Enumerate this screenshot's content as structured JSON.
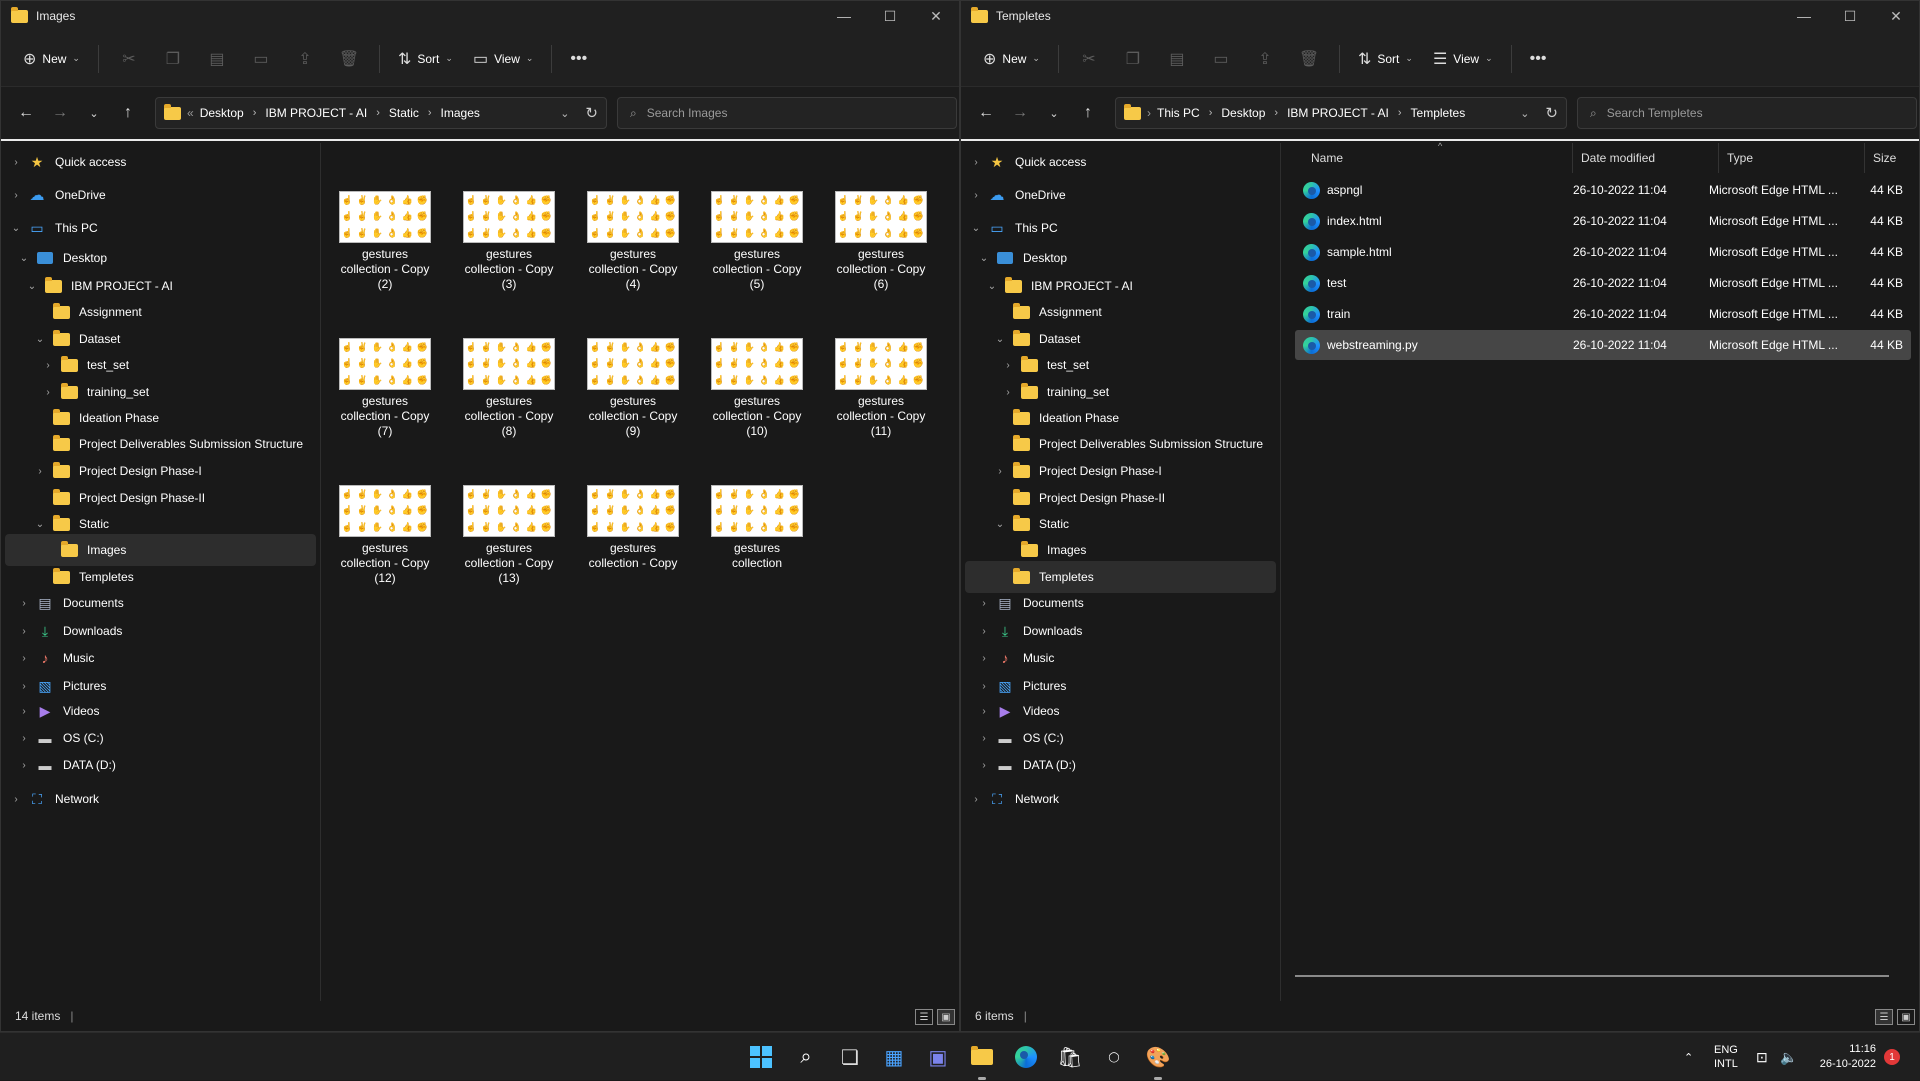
{
  "left": {
    "title": "Images",
    "toolbar": {
      "new": "New",
      "sort": "Sort",
      "view": "View"
    },
    "breadcrumb": [
      "Desktop",
      "IBM PROJECT - AI",
      "Static",
      "Images"
    ],
    "search_placeholder": "Search Images",
    "status": "14 items",
    "files": [
      [
        "gestures",
        "collection - Copy",
        "(2)"
      ],
      [
        "gestures",
        "collection - Copy",
        "(3)"
      ],
      [
        "gestures",
        "collection - Copy",
        "(4)"
      ],
      [
        "gestures",
        "collection - Copy",
        "(5)"
      ],
      [
        "gestures",
        "collection - Copy",
        "(6)"
      ],
      [
        "gestures",
        "collection - Copy",
        "(7)"
      ],
      [
        "gestures",
        "collection - Copy",
        "(8)"
      ],
      [
        "gestures",
        "collection - Copy",
        "(9)"
      ],
      [
        "gestures",
        "collection - Copy",
        "(10)"
      ],
      [
        "gestures",
        "collection - Copy",
        "(11)"
      ],
      [
        "gestures",
        "collection - Copy",
        "(12)"
      ],
      [
        "gestures",
        "collection - Copy",
        "(13)"
      ],
      [
        "gestures",
        "collection - Copy",
        ""
      ],
      [
        "gestures",
        "collection",
        ""
      ]
    ]
  },
  "right": {
    "title": "Templetes",
    "toolbar": {
      "new": "New",
      "sort": "Sort",
      "view": "View"
    },
    "breadcrumb": [
      "This PC",
      "Desktop",
      "IBM PROJECT - AI",
      "Templetes"
    ],
    "search_placeholder": "Search Templetes",
    "status": "6 items",
    "columns": [
      "Name",
      "Date modified",
      "Type",
      "Size"
    ],
    "rows": [
      {
        "name": "aspngl",
        "date": "26-10-2022 11:04",
        "type": "Microsoft Edge HTML ...",
        "size": "44 KB"
      },
      {
        "name": "index.html",
        "date": "26-10-2022 11:04",
        "type": "Microsoft Edge HTML ...",
        "size": "44 KB"
      },
      {
        "name": "sample.html",
        "date": "26-10-2022 11:04",
        "type": "Microsoft Edge HTML ...",
        "size": "44 KB"
      },
      {
        "name": "test",
        "date": "26-10-2022 11:04",
        "type": "Microsoft Edge HTML ...",
        "size": "44 KB"
      },
      {
        "name": "train",
        "date": "26-10-2022 11:04",
        "type": "Microsoft Edge HTML ...",
        "size": "44 KB"
      },
      {
        "name": "webstreaming.py",
        "date": "26-10-2022 11:04",
        "type": "Microsoft Edge HTML ...",
        "size": "44 KB"
      }
    ]
  },
  "nav": [
    {
      "label": "Quick access",
      "icon": "star-icon",
      "level": 0,
      "exp": "›"
    },
    {
      "label": "OneDrive",
      "icon": "cloud-icon",
      "level": 0,
      "exp": "›"
    },
    {
      "label": "This PC",
      "icon": "pc-icon",
      "level": 0,
      "exp": "⌄"
    },
    {
      "label": "Desktop",
      "icon": "desktop-icon",
      "level": 1,
      "exp": "⌄"
    },
    {
      "label": "IBM PROJECT - AI",
      "icon": "folder-icon",
      "level": 2,
      "exp": "⌄"
    },
    {
      "label": "Assignment",
      "icon": "folder-icon",
      "level": 3,
      "exp": ""
    },
    {
      "label": "Dataset",
      "icon": "folder-icon",
      "level": 3,
      "exp": "⌄"
    },
    {
      "label": "test_set",
      "icon": "folder-icon",
      "level": 4,
      "exp": "›"
    },
    {
      "label": "training_set",
      "icon": "folder-icon",
      "level": 4,
      "exp": "›"
    },
    {
      "label": "Ideation Phase",
      "icon": "folder-icon",
      "level": 3,
      "exp": ""
    },
    {
      "label": "Project Deliverables Submission Structure",
      "icon": "folder-icon",
      "level": 3,
      "exp": ""
    },
    {
      "label": "Project Design Phase-I",
      "icon": "folder-icon",
      "level": 3,
      "exp": "›"
    },
    {
      "label": "Project Design Phase-II",
      "icon": "folder-icon",
      "level": 3,
      "exp": ""
    },
    {
      "label": "Static",
      "icon": "folder-icon",
      "level": 3,
      "exp": "⌄"
    },
    {
      "label": "Images",
      "icon": "folder-icon",
      "level": 4,
      "exp": ""
    },
    {
      "label": "Templetes",
      "icon": "folder-icon",
      "level": 3,
      "exp": ""
    },
    {
      "label": "Documents",
      "icon": "documents-icon",
      "level": 1,
      "exp": "›"
    },
    {
      "label": "Downloads",
      "icon": "downloads-icon",
      "level": 1,
      "exp": "›"
    },
    {
      "label": "Music",
      "icon": "music-icon",
      "level": 1,
      "exp": "›"
    },
    {
      "label": "Pictures",
      "icon": "pictures-icon",
      "level": 1,
      "exp": "›"
    },
    {
      "label": "Videos",
      "icon": "videos-icon",
      "level": 1,
      "exp": "›"
    },
    {
      "label": "OS (C:)",
      "icon": "drive-c-icon",
      "level": 1,
      "exp": "›"
    },
    {
      "label": "DATA (D:)",
      "icon": "drive-d-icon",
      "level": 1,
      "exp": "›"
    },
    {
      "label": "Network",
      "icon": "network-icon",
      "level": 0,
      "exp": "›"
    }
  ],
  "taskbar": {
    "lang": "ENG",
    "layout": "INTL",
    "time": "11:16",
    "date": "26-10-2022",
    "notifications": "1",
    "apps": [
      "start-icon",
      "search-icon",
      "task-view-icon",
      "widgets-icon",
      "teams-chat-icon",
      "file-explorer-icon",
      "edge-icon",
      "store-icon",
      "dell-icon",
      "paint-icon"
    ]
  },
  "colors": {
    "folder": "#f7c948",
    "selection": "#2d2d2d",
    "accent": "#0078d4"
  }
}
